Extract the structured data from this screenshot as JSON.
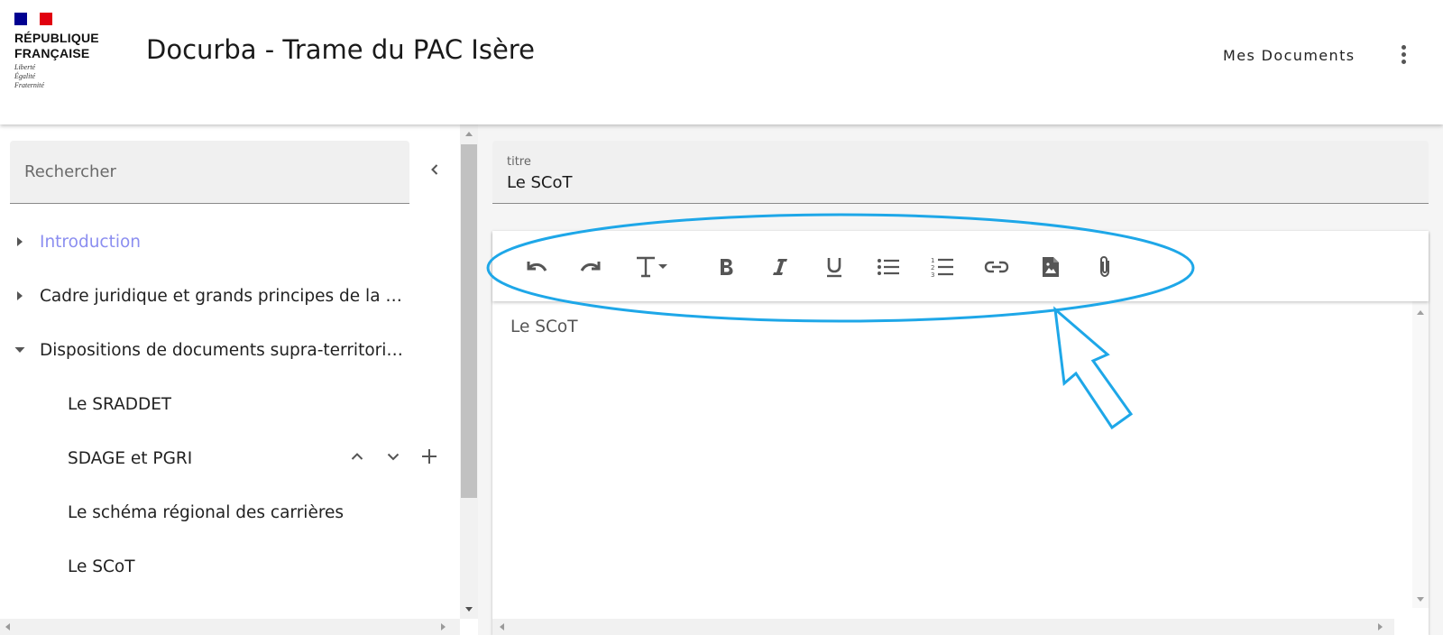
{
  "header": {
    "republique": "RÉPUBLIQUE\nFRANÇAISE",
    "motto": "Liberté\nÉgalité\nFraternité",
    "title": "Docurba - Trame du PAC Isère",
    "mes_documents": "Mes Documents",
    "flag_colors": [
      "#000091",
      "#ffffff",
      "#e1000f"
    ]
  },
  "sidebar": {
    "search_placeholder": "Rechercher",
    "items": [
      {
        "label": "Introduction",
        "state": "collapsed",
        "active": true
      },
      {
        "label": "Cadre juridique et grands principes de la planification",
        "state": "collapsed"
      },
      {
        "label": "Dispositions de documents supra-territoriaux",
        "state": "expanded",
        "children": [
          {
            "label": "Le SRADDET"
          },
          {
            "label": "SDAGE et PGRI"
          },
          {
            "label": "Le schéma régional des carrières"
          },
          {
            "label": "Le SCoT"
          }
        ]
      }
    ]
  },
  "main": {
    "titre_label": "titre",
    "titre_value": "Le SCoT",
    "editor_content": "Le SCoT",
    "toolbar": [
      "undo-icon",
      "redo-icon",
      "text-format-icon",
      "bold-icon",
      "italic-icon",
      "underline-icon",
      "bullet-list-icon",
      "numbered-list-icon",
      "link-icon",
      "image-icon",
      "attachment-icon"
    ]
  },
  "colors": {
    "accent": "#8b8ef0",
    "annotation": "#1ea7e8"
  }
}
